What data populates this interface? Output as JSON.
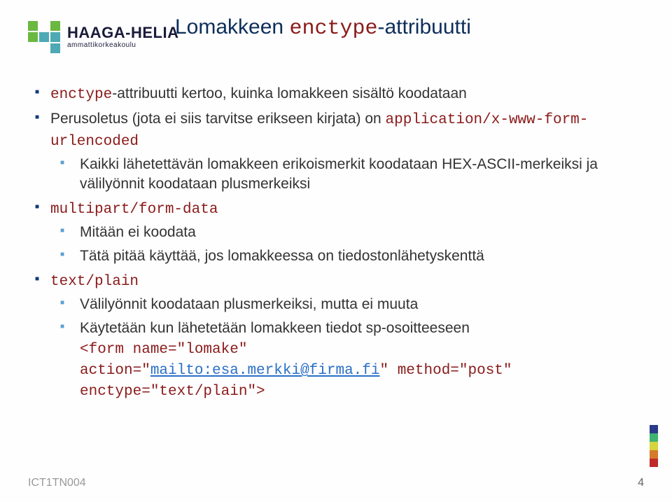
{
  "logo": {
    "main": "HAAGA-HELIA",
    "sub": "ammattikorkeakoulu"
  },
  "title": {
    "pre": "Lomakkeen ",
    "code": "enctype",
    "post": "-attribuutti"
  },
  "bullets": {
    "i0": {
      "code": "enctype",
      "text": "-attribuutti kertoo, kuinka lomakkeen sisältö koodataan"
    },
    "i1": {
      "pre": "Perusoletus (jota ei siis tarvitse erikseen kirjata) on ",
      "code": "application/x-www-form-urlencoded",
      "sub": "Kaikki lähetettävän lomakkeen erikoismerkit koodataan HEX-ASCII-merkeiksi ja välilyönnit koodataan plusmerkeiksi"
    },
    "i2": {
      "code": "multipart/form-data",
      "sub1": "Mitään ei koodata",
      "sub2": "Tätä pitää käyttää, jos lomakkeessa on tiedostonlähetyskenttä"
    },
    "i3": {
      "code": "text/plain",
      "sub1": "Välilyönnit koodataan plusmerkeiksi, mutta ei muuta",
      "sub2": "Käytetään kun lähetetään lomakkeen tiedot sp-osoitteeseen",
      "code1": "<form name=\"lomake\"",
      "code2a": "action=\"",
      "link": "mailto:esa.merkki@firma.fi",
      "code2b": "\" method=\"post\"",
      "code3": "enctype=\"text/plain\">"
    }
  },
  "footer": {
    "code": "ICT1TN004",
    "page": "4"
  },
  "stripColors": [
    "#2a3a8a",
    "#3cb371",
    "#d4d43c",
    "#d47a2a",
    "#c02a2a"
  ]
}
